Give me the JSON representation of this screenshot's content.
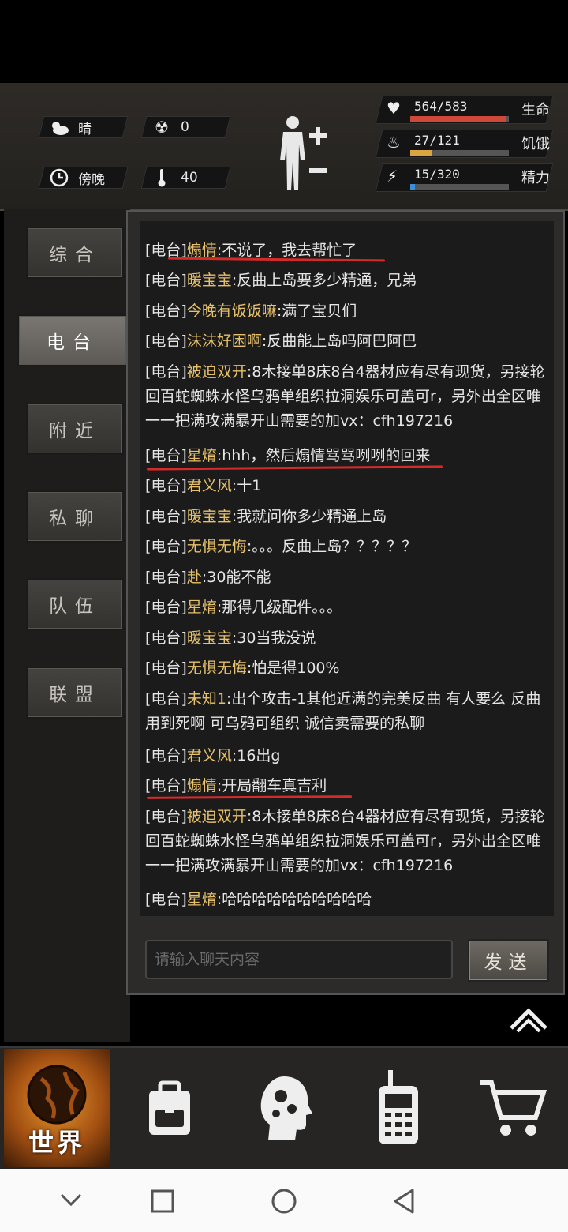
{
  "status": {
    "weather": "晴",
    "radiation": "0",
    "time_of_day": "傍晚",
    "temperature": "40"
  },
  "bars": [
    {
      "name": "生命",
      "value": "564/583",
      "fill": 0.967,
      "color": "#d0483a"
    },
    {
      "name": "饥饿",
      "value": "27/121",
      "fill": 0.223,
      "color": "#d9a441"
    },
    {
      "name": "精力",
      "value": "15/320",
      "fill": 0.047,
      "color": "#3a8fd6"
    }
  ],
  "tabs": [
    {
      "label": "综合"
    },
    {
      "label": "电台"
    },
    {
      "label": "附近"
    },
    {
      "label": "私聊"
    },
    {
      "label": "队伍"
    },
    {
      "label": "联盟"
    }
  ],
  "active_tab": "电台",
  "messages": [
    {
      "tag": "[电台]",
      "name": "煽情",
      "text": ":不说了，我去帮忙了"
    },
    {
      "tag": "[电台]",
      "name": "暖宝宝",
      "text": ":反曲上岛要多少精通，兄弟"
    },
    {
      "tag": "[电台]",
      "name": "今晚有饭饭嘛",
      "text": ":满了宝贝们"
    },
    {
      "tag": "[电台]",
      "name": "沫沫好困啊",
      "text": ":反曲能上岛吗阿巴阿巴"
    },
    {
      "tag": "[电台]",
      "name": "被迫双开",
      "text": ":8木接单8床8台4器材应有尽有现货，另接轮回百蛇蜘蛛水怪乌鸦单组织拉洞娱乐可盖可r，另外出全区唯一一把满攻满暴开山需要的加vx：cfh197216"
    },
    {
      "tag": "[电台]",
      "name": "星焴",
      "text": ":hhh，然后煽情骂骂咧咧的回来"
    },
    {
      "tag": "[电台]",
      "name": "君义风",
      "text": ":十1"
    },
    {
      "tag": "[电台]",
      "name": "暖宝宝",
      "text": ":我就问你多少精通上岛"
    },
    {
      "tag": "[电台]",
      "name": "无惧无悔",
      "text": ":。。。反曲上岛？？？？？"
    },
    {
      "tag": "[电台]",
      "name": "赴",
      "text": ":30能不能"
    },
    {
      "tag": "[电台]",
      "name": "星焴",
      "text": ":那得几级配件。。。"
    },
    {
      "tag": "[电台]",
      "name": "暖宝宝",
      "text": ":30当我没说"
    },
    {
      "tag": "[电台]",
      "name": "无惧无悔",
      "text": ":怕是得100%"
    },
    {
      "tag": "[电台]",
      "name": "未知1",
      "text": ":出个攻击-1其他近满的完美反曲 有人要么 反曲用到死啊 可乌鸦可组织 诚信卖需要的私聊"
    },
    {
      "tag": "[电台]",
      "name": "君义风",
      "text": ":16出g"
    },
    {
      "tag": "[电台]",
      "name": "煽情",
      "text": ":开局翻车真吉利"
    },
    {
      "tag": "[电台]",
      "name": "被迫双开",
      "text": ":8木接单8床8台4器材应有尽有现货，另接轮回百蛇蜘蛛水怪乌鸦单组织拉洞娱乐可盖可r，另外出全区唯一一把满攻满暴开山需要的加vx：cfh197216"
    },
    {
      "tag": "[电台]",
      "name": "星焴",
      "text": ":哈哈哈哈哈哈哈哈哈哈"
    }
  ],
  "input": {
    "placeholder": "请输入聊天内容",
    "value": ""
  },
  "send_label": "发送",
  "bottom_nav": {
    "world_label": "世界",
    "items": [
      {
        "icon": "globe-icon"
      },
      {
        "icon": "backpack-icon"
      },
      {
        "icon": "head-gears-icon"
      },
      {
        "icon": "walkie-talkie-icon"
      },
      {
        "icon": "shopping-cart-icon"
      }
    ]
  }
}
